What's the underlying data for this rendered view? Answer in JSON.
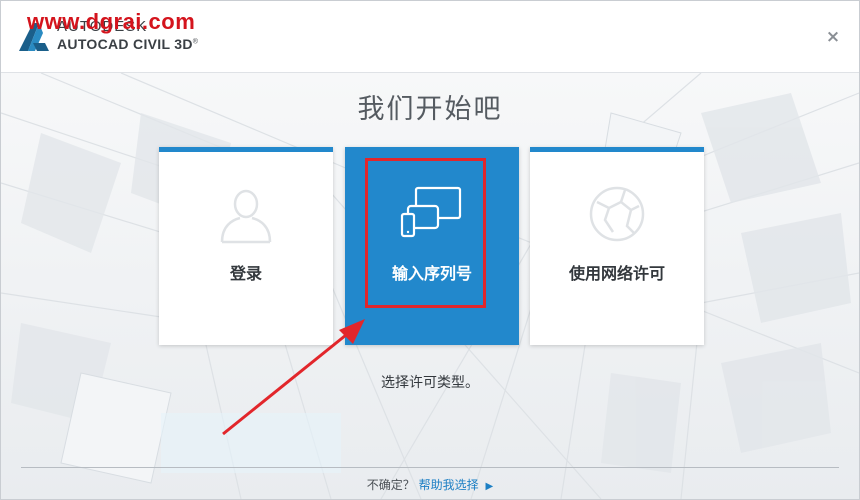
{
  "header": {
    "watermark": "www.dgrai.com",
    "brand_company": "AUTODESK",
    "brand_product": "AUTOCAD CIVIL 3D",
    "brand_mark": "®",
    "close_glyph": "×"
  },
  "main": {
    "title": "我们开始吧",
    "cards": [
      {
        "label": "登录",
        "icon": "user-silhouette-icon",
        "selected": false
      },
      {
        "label": "输入序列号",
        "icon": "devices-icon",
        "selected": true
      },
      {
        "label": "使用网络许可",
        "icon": "globe-network-icon",
        "selected": false
      }
    ],
    "subtitle": "选择许可类型。"
  },
  "footer": {
    "prompt": "不确定？",
    "help_link": "帮助我选择",
    "help_arrow": "▶"
  },
  "colors": {
    "accent_blue": "#2288cc",
    "highlight_red": "#e2262b",
    "link_blue": "#1d7fc4"
  }
}
